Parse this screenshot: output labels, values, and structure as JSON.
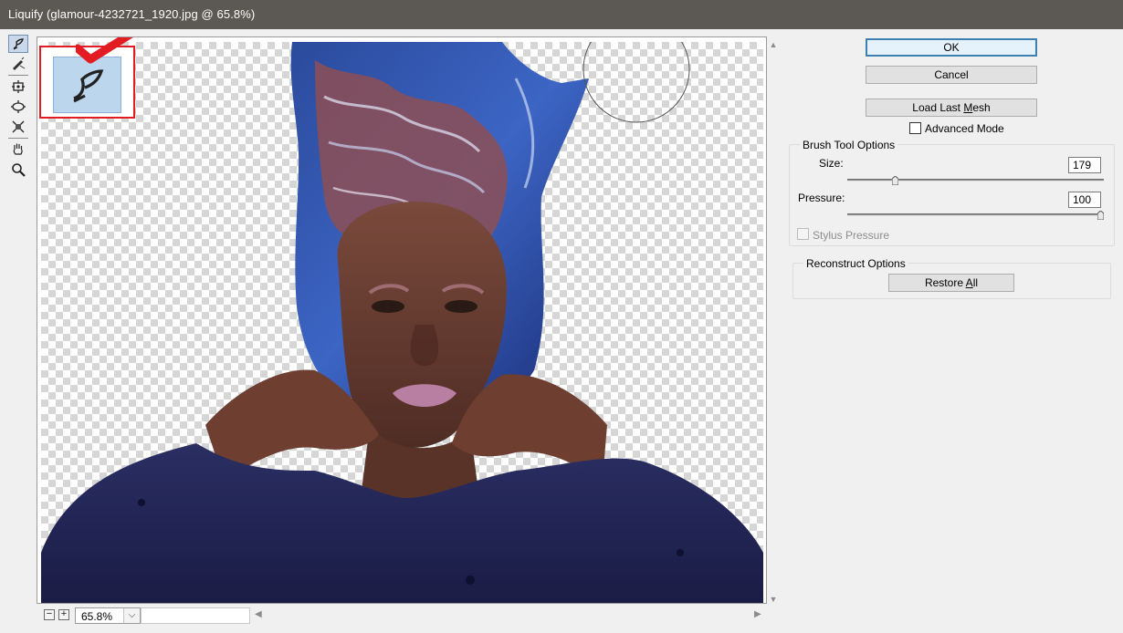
{
  "window": {
    "title": "Liquify (glamour-4232721_1920.jpg @ 65.8%)"
  },
  "toolbar": {
    "tools": [
      {
        "name": "forward-warp-tool-icon",
        "active": true
      },
      {
        "name": "reconstruct-tool-icon",
        "active": false
      },
      {
        "name": "pucker-tool-icon",
        "active": false
      },
      {
        "name": "bloat-tool-icon",
        "active": false
      },
      {
        "name": "freeze-mask-tool-icon",
        "active": false
      },
      {
        "name": "hand-tool-icon",
        "active": false
      },
      {
        "name": "zoom-tool-icon",
        "active": false
      }
    ]
  },
  "zoom": {
    "minus": "−",
    "plus": "+",
    "value": "65.8%"
  },
  "buttons": {
    "ok": "OK",
    "cancel": "Cancel",
    "load_last_mesh_pre": "Load Last ",
    "load_last_mesh_u": "M",
    "load_last_mesh_post": "esh"
  },
  "advanced_mode": {
    "label": "Advanced Mode",
    "checked": false
  },
  "brush_tool_options": {
    "title": "Brush Tool Options",
    "size_label": "Size:",
    "size_value": "179",
    "size_fraction": 0.18,
    "pressure_label": "Pressure:",
    "pressure_value": "100",
    "pressure_fraction": 1.0,
    "stylus_pressure_label": "Stylus Pressure",
    "stylus_pressure_checked": false
  },
  "reconstruct_options": {
    "title": "Reconstruct Options",
    "restore_all_pre": "Restore ",
    "restore_all_u": "A",
    "restore_all_post": "ll"
  },
  "colors": {
    "title_bar": "#5c5853",
    "accent": "#3c7fb1",
    "highlight_box": "#e31b23"
  }
}
